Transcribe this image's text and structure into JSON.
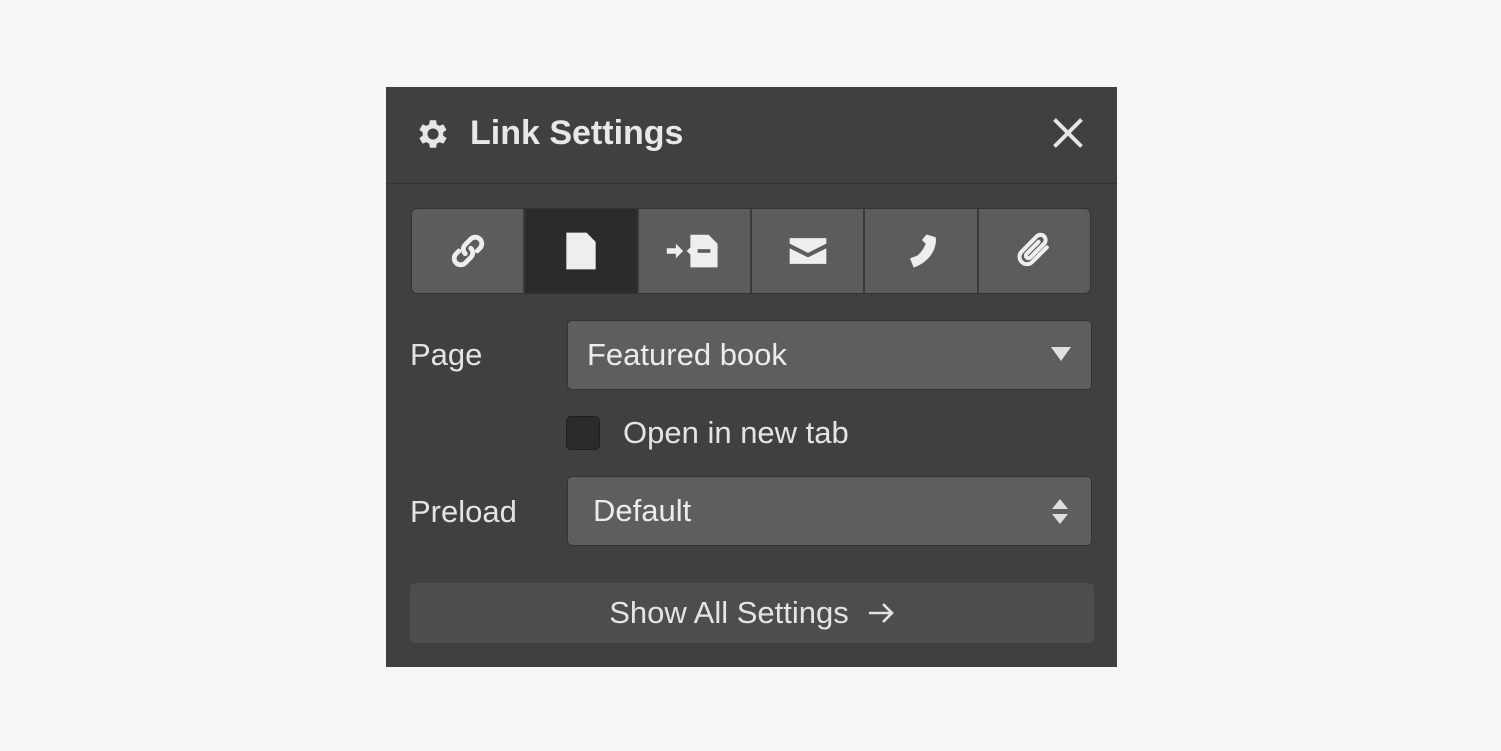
{
  "panel": {
    "title": "Link Settings",
    "header_icon": "gear-icon",
    "close_icon": "close-icon"
  },
  "link_types": [
    {
      "name": "url",
      "icon": "link-icon",
      "active": false
    },
    {
      "name": "page",
      "icon": "page-icon",
      "active": true
    },
    {
      "name": "page-section",
      "icon": "section-arrow-icon",
      "active": false
    },
    {
      "name": "email",
      "icon": "email-icon",
      "active": false
    },
    {
      "name": "phone",
      "icon": "phone-icon",
      "active": false
    },
    {
      "name": "file",
      "icon": "paperclip-icon",
      "active": false
    }
  ],
  "page_field": {
    "label": "Page",
    "value": "Featured book"
  },
  "new_tab": {
    "label": "Open in new tab",
    "checked": false
  },
  "preload_field": {
    "label": "Preload",
    "value": "Default"
  },
  "show_all": {
    "label": "Show All Settings",
    "icon": "arrow-right-icon"
  },
  "colors": {
    "page_bg": "#f5f6f8",
    "panel_bg": "#404040",
    "active_tab_bg": "#2b2b2b",
    "input_bg": "#5e5e5e",
    "text": "#e4e4e4"
  }
}
